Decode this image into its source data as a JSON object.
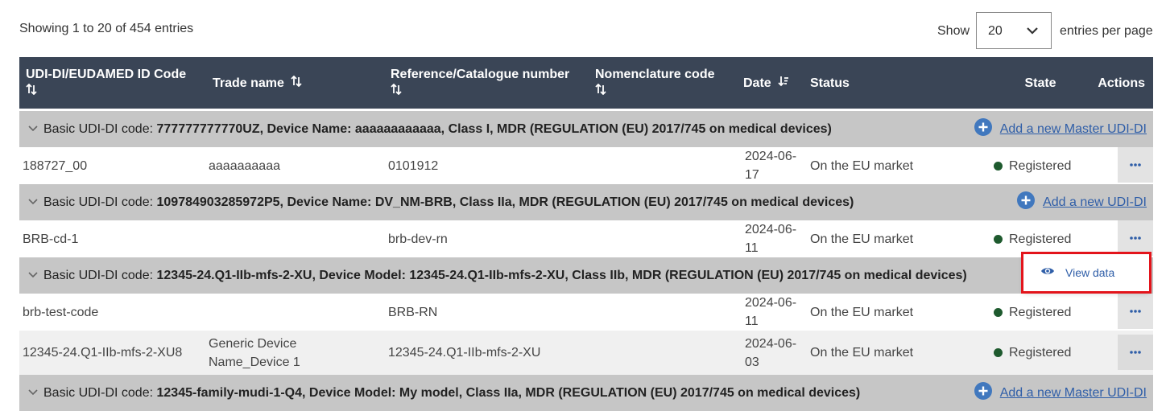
{
  "info": {
    "showing": "Showing 1 to 20 of 454 entries"
  },
  "page_size": {
    "show_label": "Show",
    "value": "20",
    "suffix": "entries per page"
  },
  "columns": {
    "udi": "UDI-DI/EUDAMED ID Code",
    "trade": "Trade name",
    "ref": "Reference/Catalogue number",
    "nomen": "Nomenclature code",
    "date": "Date",
    "status": "Status",
    "state": "State",
    "actions": "Actions"
  },
  "groups": [
    {
      "prefix": "Basic UDI-DI code: ",
      "detail": "777777777770UZ, Device Name: aaaaaaaaaaaa,  Class I,  MDR (REGULATION (EU) 2017/745 on medical devices)",
      "link": "Add a new Master UDI-DI",
      "rows": [
        {
          "udi": "188727_00",
          "trade": "aaaaaaaaaa",
          "ref": "0101912",
          "nomen": "",
          "date": "2024-06-17",
          "status": "On the EU market",
          "state": "Registered"
        }
      ]
    },
    {
      "prefix": "Basic UDI-DI code: ",
      "detail": "109784903285972P5, Device Name: DV_NM-BRB,  Class IIa,  MDR (REGULATION (EU) 2017/745 on medical devices)",
      "link": "Add a new UDI-DI",
      "rows": [
        {
          "udi": "BRB-cd-1",
          "trade": "",
          "ref": "brb-dev-rn",
          "nomen": "",
          "date": "2024-06-11",
          "status": "On the EU market",
          "state": "Registered"
        }
      ]
    },
    {
      "prefix": "Basic UDI-DI code: ",
      "detail": "12345-24.Q1-IIb-mfs-2-XU, Device Model: 12345-24.Q1-IIb-mfs-2-XU,  Class IIb,  MDR (REGULATION (EU) 2017/745 on medical devices)",
      "link": "",
      "rows": [
        {
          "udi": "brb-test-code",
          "trade": "",
          "ref": "BRB-RN",
          "nomen": "",
          "date": "2024-06-11",
          "status": "On the EU market",
          "state": "Registered"
        },
        {
          "udi": "12345-24.Q1-IIb-mfs-2-XU8",
          "trade": "Generic Device Name_Device 1",
          "ref": "12345-24.Q1-IIb-mfs-2-XU",
          "nomen": "",
          "date": "2024-06-03",
          "status": "On the EU market",
          "state": "Registered"
        }
      ]
    },
    {
      "prefix": "Basic UDI-DI code: ",
      "detail": "12345-family-mudi-1-Q4, Device Model: My model,  Class IIa,  MDR (REGULATION (EU) 2017/745 on medical devices)",
      "link": "Add a new Master UDI-DI",
      "rows": []
    }
  ],
  "popup": {
    "item_label": "View data",
    "icon": "eye-icon"
  },
  "colors": {
    "header_bg": "#3a4556",
    "group_bg": "#c6c6c6",
    "link": "#2f5ea8",
    "plus_icon": "#4178be",
    "registered_dot": "#1e5a2e",
    "highlight": "#e3141b"
  }
}
